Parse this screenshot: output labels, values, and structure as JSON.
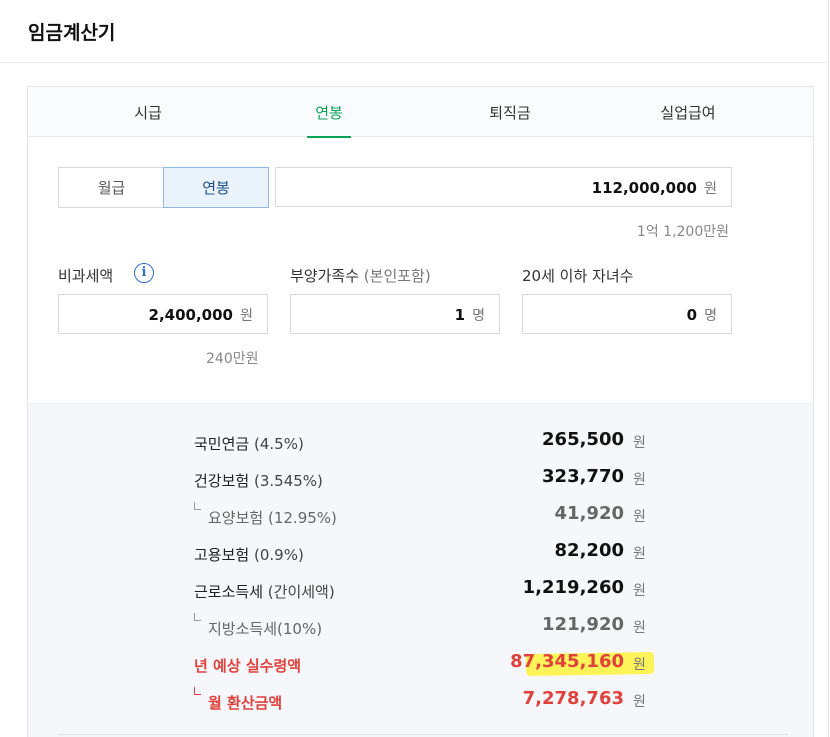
{
  "header": {
    "title": "임금계산기"
  },
  "tabs": [
    {
      "label": "시급",
      "active": false
    },
    {
      "label": "연봉",
      "active": true
    },
    {
      "label": "퇴직금",
      "active": false
    },
    {
      "label": "실업급여",
      "active": false
    }
  ],
  "mode": {
    "monthly_label": "월급",
    "annual_label": "연봉",
    "selected": "연봉"
  },
  "salary": {
    "value": "112,000,000",
    "unit": "원",
    "hint": "1억 1,200만원"
  },
  "nontax": {
    "label": "비과세액",
    "info_icon": "info-icon",
    "value": "2,400,000",
    "unit": "원",
    "hint": "240만원"
  },
  "dependents": {
    "label": "부양가족수",
    "label_sub": "(본인포함)",
    "value": "1",
    "unit": "명"
  },
  "children": {
    "label": "20세 이하 자녀수",
    "value": "0",
    "unit": "명"
  },
  "results": {
    "rows": [
      {
        "label": "국민연금",
        "paren": "(4.5%)",
        "value": "265,500",
        "unit": "원"
      },
      {
        "label": "건강보험",
        "paren": "(3.545%)",
        "value": "323,770",
        "unit": "원"
      },
      {
        "label": "요양보험",
        "paren": "(12.95%)",
        "value": "41,920",
        "unit": "원"
      },
      {
        "label": "고용보험",
        "paren": "(0.9%)",
        "value": "82,200",
        "unit": "원"
      },
      {
        "label": "근로소득세",
        "paren": "(간이세액)",
        "value": "1,219,260",
        "unit": "원"
      },
      {
        "label": "지방소득세",
        "paren": "(10%)",
        "value": "121,920",
        "unit": "원"
      },
      {
        "label": "년 예상 실수령액",
        "paren": "",
        "value": "87,345,160",
        "unit": "원"
      },
      {
        "label": "월 환산금액",
        "paren": "",
        "value": "7,278,763",
        "unit": "원"
      }
    ]
  },
  "colors": {
    "accent_green": "#0aa35a",
    "result_red": "#e0413a",
    "highlight_yellow": "#fff35a",
    "info_blue": "#2f6fd0"
  }
}
